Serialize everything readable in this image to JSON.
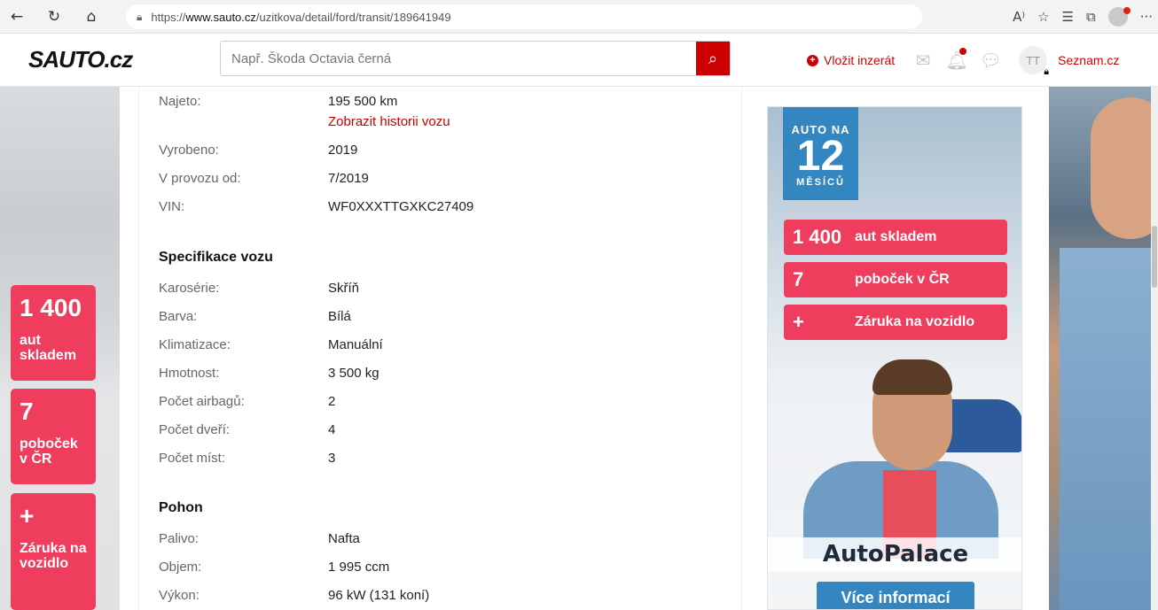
{
  "browser": {
    "url_scheme": "https://",
    "url_host": "www.sauto.cz",
    "url_path": "/uzitkova/detail/ford/transit/189641949",
    "icons": [
      "back-icon",
      "refresh-icon",
      "home-icon",
      "lock-icon",
      "read-aloud-icon",
      "favorite-icon",
      "favorites-list-icon",
      "collections-icon",
      "more-icon"
    ],
    "more_label": "···"
  },
  "header": {
    "logo": "SAUTO.cz",
    "search_placeholder": "Např. Škoda Octavia černá",
    "post_ad_label": "Vložit inzerát",
    "avatar_initials": "TT",
    "seznam_label": "Seznam.cz"
  },
  "left_promo": [
    {
      "big": "1 400",
      "text": "aut skladem"
    },
    {
      "big": "7",
      "text": "poboček v ČR"
    },
    {
      "big": "+",
      "text": "Záruka na vozidlo"
    }
  ],
  "details": {
    "mileage": {
      "label": "Najeto:",
      "value": "195 500 km"
    },
    "history_link": "Zobrazit historii vozu",
    "basic": [
      {
        "label": "Vyrobeno:",
        "value": "2019"
      },
      {
        "label": "V provozu od:",
        "value": "7/2019"
      },
      {
        "label": "VIN:",
        "value": "WF0XXXTTGXKC27409"
      }
    ],
    "spec_title": "Specifikace vozu",
    "spec": [
      {
        "label": "Karosérie:",
        "value": "Skříň"
      },
      {
        "label": "Barva:",
        "value": "Bílá"
      },
      {
        "label": "Klimatizace:",
        "value": "Manuální"
      },
      {
        "label": "Hmotnost:",
        "value": "3 500 kg"
      },
      {
        "label": "Počet airbagů:",
        "value": "2"
      },
      {
        "label": "Počet dveří:",
        "value": "4"
      },
      {
        "label": "Počet míst:",
        "value": "3"
      }
    ],
    "drive_title": "Pohon",
    "drive": [
      {
        "label": "Palivo:",
        "value": "Nafta"
      },
      {
        "label": "Objem:",
        "value": "1 995 ccm"
      },
      {
        "label": "Výkon:",
        "value": "96 kW (131 koní)"
      }
    ]
  },
  "ad": {
    "tag_top": "AUTO NA",
    "tag_number": "12",
    "tag_bottom": "MĚSÍCŮ",
    "pills": [
      {
        "k": "1 400",
        "v": "aut skladem"
      },
      {
        "k": "7",
        "v": "poboček v ČR"
      },
      {
        "k": "+",
        "v": "Záruka na vozidlo"
      }
    ],
    "brand": "AutoPalace",
    "cta": "Více informací"
  },
  "colors": {
    "brand_red": "#cc0000",
    "promo_pink": "#ef3d5e",
    "ad_blue": "#3386c0"
  }
}
